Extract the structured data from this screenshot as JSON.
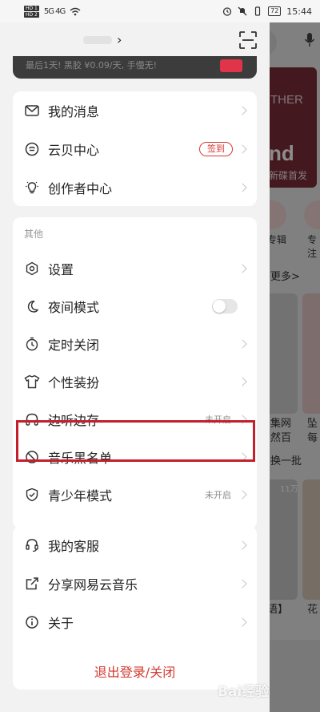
{
  "status_bar": {
    "sim1": "HD 1",
    "sim2": "HD 2",
    "signal": "5G 4G",
    "battery": "72",
    "time": "15:44"
  },
  "header": {
    "chevron": "›"
  },
  "vip_banner": {
    "text": "最后1天! 黑胶 ¥0.09/天, 手慢无!"
  },
  "group_a": [
    {
      "label": "我的消息",
      "icon": "mail-icon"
    },
    {
      "label": "云贝中心",
      "icon": "cloud-coin-icon",
      "action": "签到"
    },
    {
      "label": "创作者中心",
      "icon": "lightbulb-icon"
    }
  ],
  "group_b": {
    "title": "其他",
    "items": [
      {
        "label": "设置",
        "icon": "settings-icon"
      },
      {
        "label": "夜间模式",
        "icon": "moon-icon",
        "toggle": "off"
      },
      {
        "label": "定时关闭",
        "icon": "timer-icon"
      },
      {
        "label": "个性装扮",
        "icon": "tshirt-icon"
      },
      {
        "label": "边听边存",
        "icon": "headphones-icon",
        "status": "未开启"
      },
      {
        "label": "音乐黑名单",
        "icon": "block-icon"
      },
      {
        "label": "青少年模式",
        "icon": "shield-icon",
        "status": "未开启"
      }
    ]
  },
  "group_c": [
    {
      "label": "我的客服",
      "icon": "headset-icon"
    },
    {
      "label": "分享网易云音乐",
      "icon": "share-icon"
    },
    {
      "label": "关于",
      "icon": "info-icon"
    }
  ],
  "logout": {
    "label": "退出登录/关闭"
  },
  "background_app": {
    "banner_text_1": "THER",
    "banner_text_2": "nd",
    "banner_text_3": "新碟首发",
    "icon_label_1": "专辑",
    "icon_label_2": "专注",
    "more": "更多>",
    "card_text_1": "集网",
    "card_text_2": "然百",
    "card_text_3": "坠",
    "card_text_4": "每",
    "refresh": "换一批",
    "play_count": "11万",
    "bottom_text_1": "语】",
    "bottom_text_2": "花"
  },
  "watermark": "Bai经验",
  "colors": {
    "accent_red": "#d33a31",
    "highlight_box": "#c4202c"
  }
}
